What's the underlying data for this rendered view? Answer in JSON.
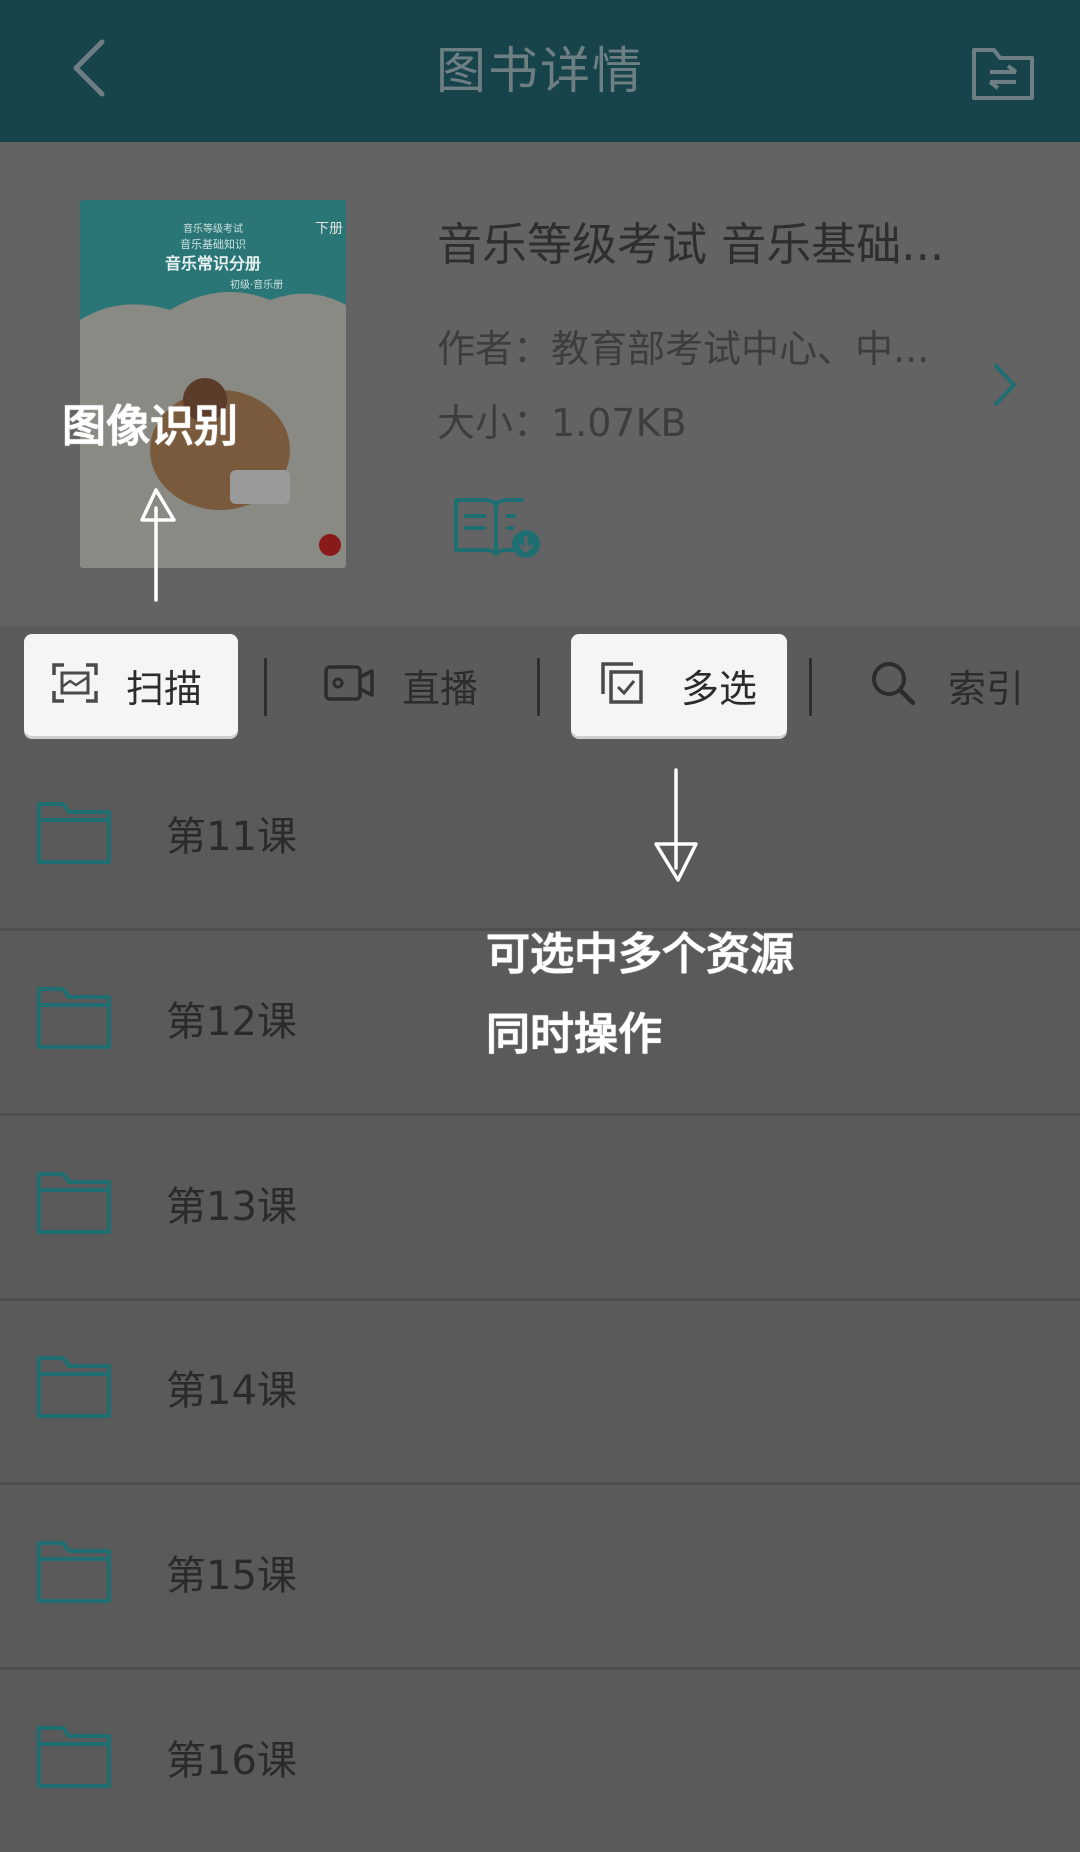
{
  "header": {
    "title": "图书详情",
    "back_icon": "back-arrow-icon",
    "right_icon": "folder-swap-icon"
  },
  "book": {
    "title": "音乐等级考试 音乐基础...",
    "author": "作者：教育部考试中心、中...",
    "size": "大小：1.07KB",
    "cover": {
      "line1": "音乐等级考试",
      "line2": "音乐基础知识",
      "title": "音乐常识分册",
      "badge": "下册",
      "sub": "初级·音乐册"
    }
  },
  "toolbar": {
    "items": [
      {
        "label": "扫描",
        "icon": "scan-icon",
        "highlighted": true
      },
      {
        "label": "直播",
        "icon": "video-camera-icon",
        "highlighted": false
      },
      {
        "label": "多选",
        "icon": "multi-select-icon",
        "highlighted": true
      },
      {
        "label": "索引",
        "icon": "search-icon",
        "highlighted": false
      }
    ]
  },
  "list": {
    "items": [
      {
        "label": "第11课"
      },
      {
        "label": "第12课"
      },
      {
        "label": "第13课"
      },
      {
        "label": "第14课"
      },
      {
        "label": "第15课"
      },
      {
        "label": "第16课"
      }
    ]
  },
  "annotations": {
    "scan_note": "图像识别",
    "multi_note_line1": "可选中多个资源",
    "multi_note_line2": "同时操作"
  },
  "colors": {
    "header_bg": "#17434a",
    "accent_teal": "#1f8a8a",
    "overlay_bg": "#5a5a5a",
    "highlight_bg": "#f5f5f5"
  }
}
